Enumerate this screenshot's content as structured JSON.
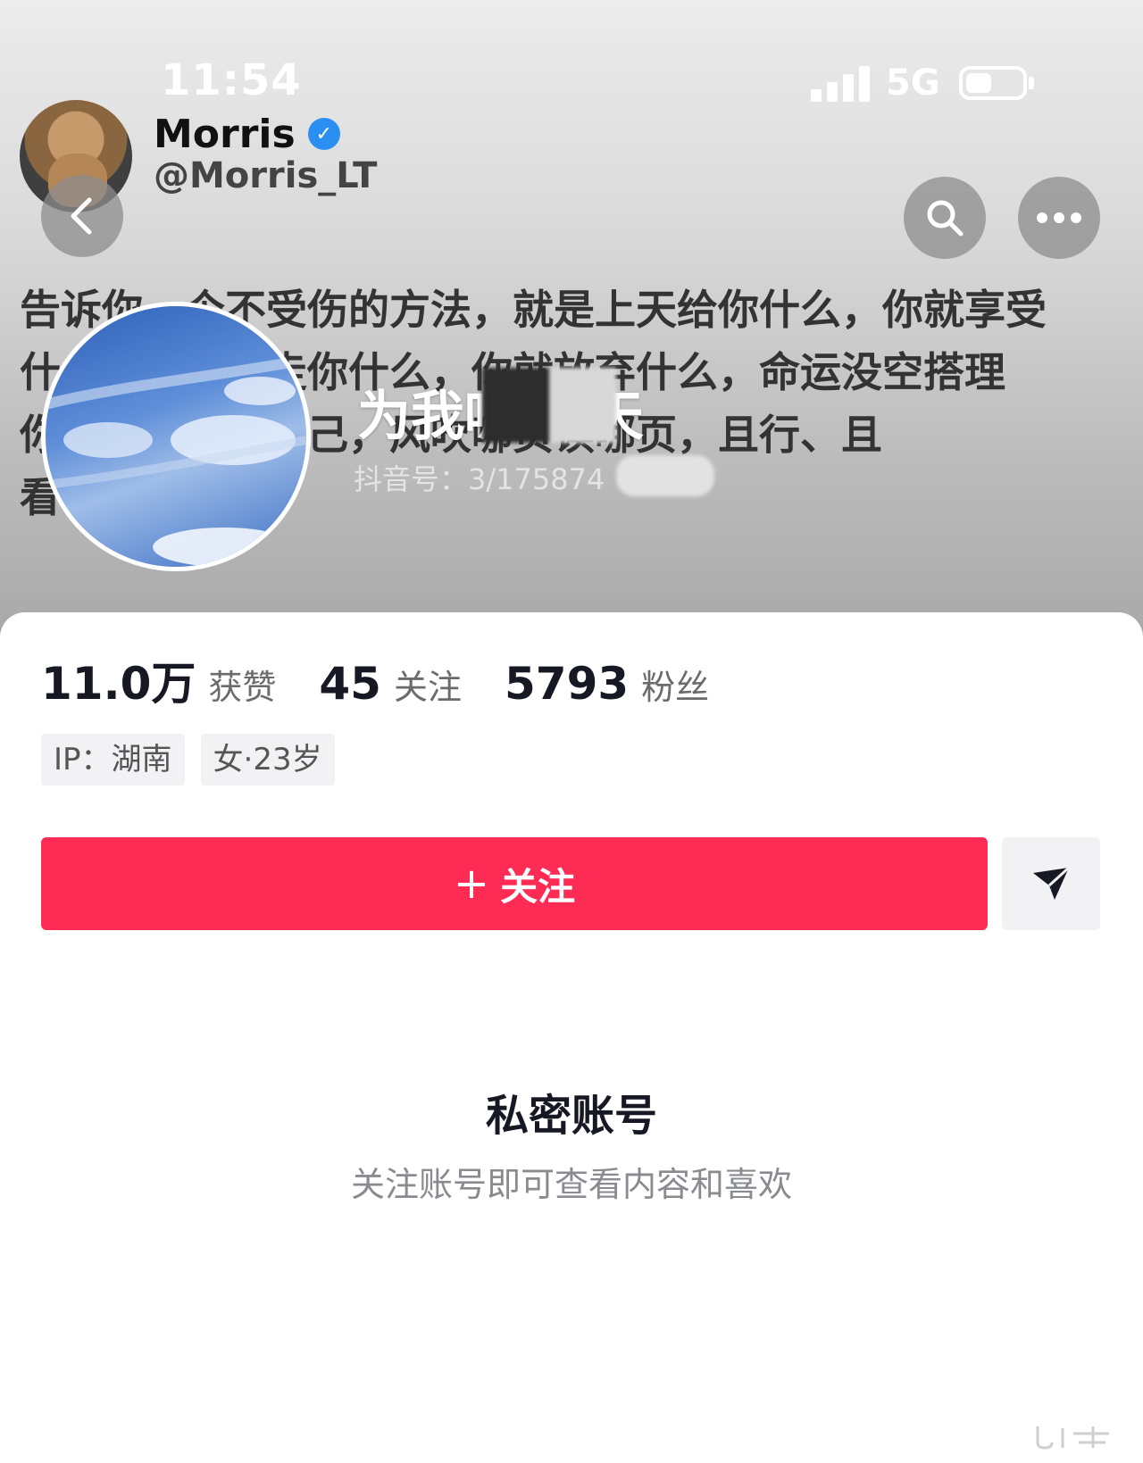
{
  "status_bar": {
    "time": "11:54",
    "network": "5G"
  },
  "tweet": {
    "display_name": "Morris",
    "handle": "@Morris_LT",
    "text": "告诉你一个不受伤的方法，就是上天给你什么，你就享受\n什么，上天拿走你什么，你就放弃什么，命运没空搭理\n你，你要爱你自己，风吹哪页读哪页，且行、且\n看"
  },
  "profile": {
    "name": "为我呢  晴天",
    "douyin_id": "抖音号：3/175874"
  },
  "stats": [
    {
      "value": "11.0万",
      "label": "获赞"
    },
    {
      "value": "45",
      "label": "关注"
    },
    {
      "value": "5793",
      "label": "粉丝"
    }
  ],
  "tags": [
    "IP：湖南",
    "女·23岁"
  ],
  "actions": {
    "follow_plus": "+",
    "follow_label": "关注"
  },
  "private": {
    "title": "私密账号",
    "subtitle": "关注账号即可查看内容和喜欢"
  },
  "icons": {
    "back": "chevron-left-icon",
    "search": "search-icon",
    "more": "more-icon",
    "message": "send-icon",
    "verified": "verified-icon"
  },
  "colors": {
    "follow_button": "#fe2c55",
    "verified": "#2b8ff2"
  }
}
